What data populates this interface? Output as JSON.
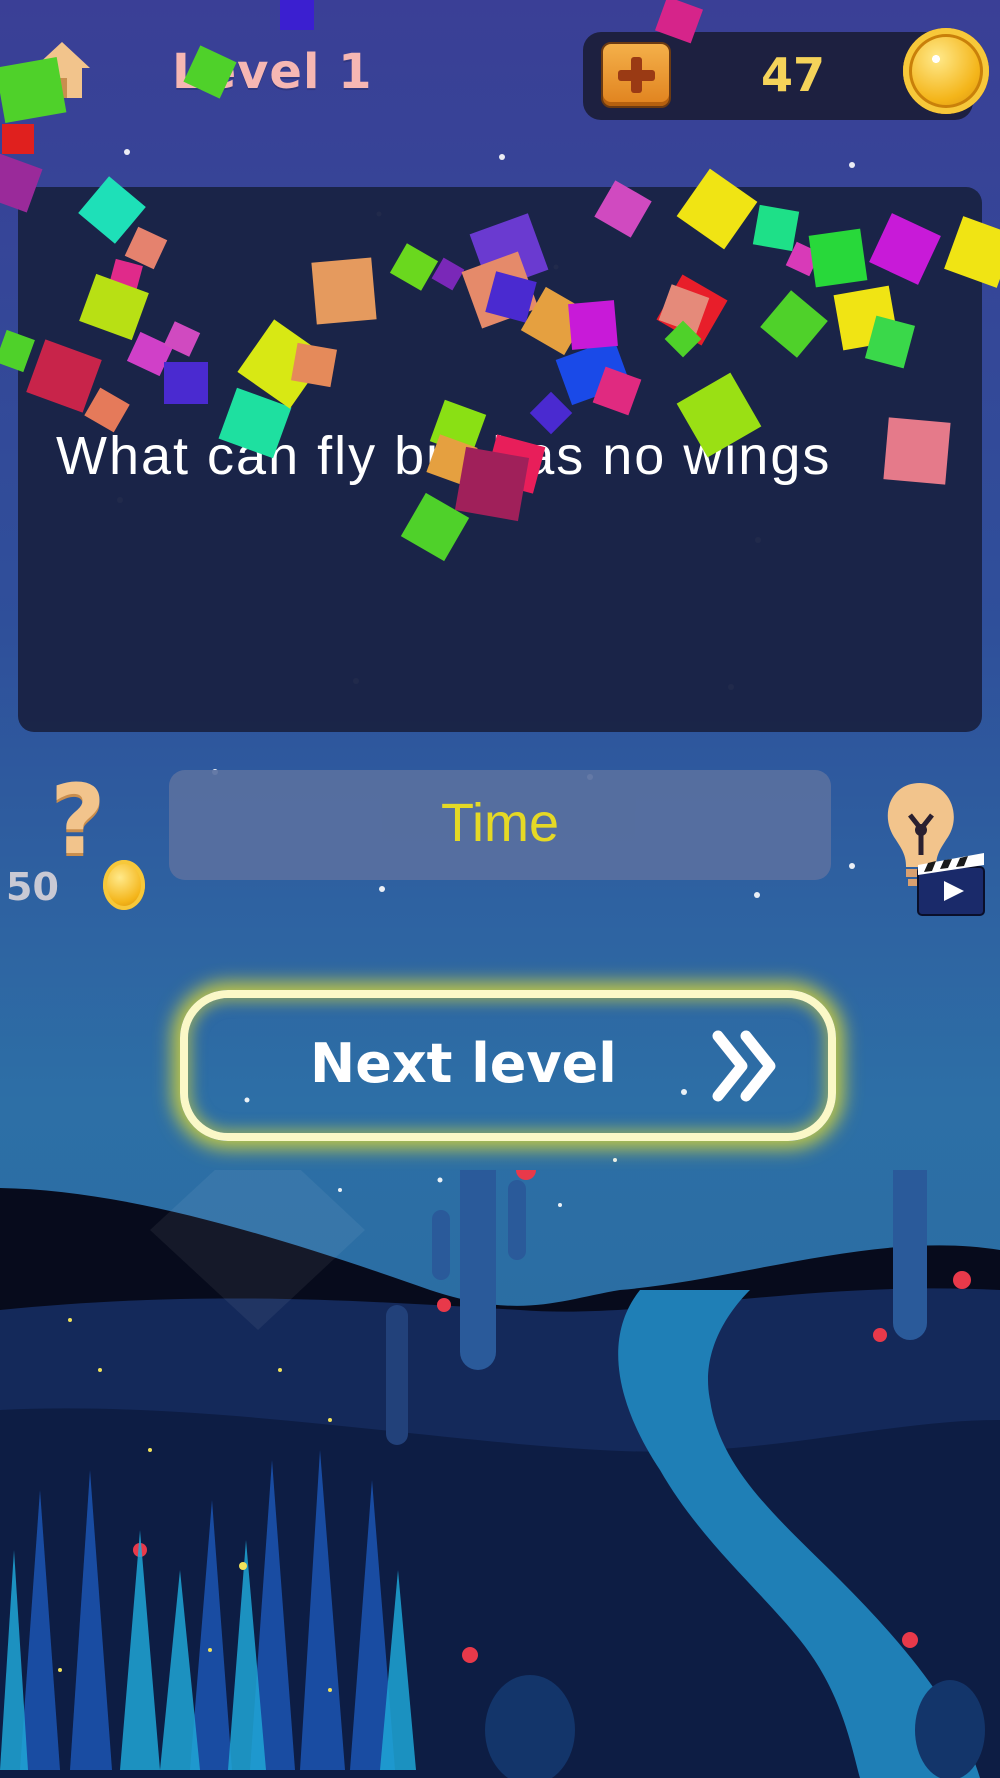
{
  "header": {
    "home_icon": "house-icon",
    "level_title": "Level 1",
    "coins": "47",
    "add_coins_icon": "plus-icon",
    "coin_icon": "gold-coin-icon"
  },
  "question": {
    "text": "What can fly but has no wings"
  },
  "hints": {
    "question_hint_icon": "question-mark-icon",
    "question_hint_cost": "50",
    "bulb_hint_icon": "lightbulb-icon",
    "video_icon": "clapperboard-play-icon"
  },
  "answer": {
    "text": "Time"
  },
  "next_button": {
    "label": "Next level",
    "icon": "double-chevron-right-icon"
  },
  "colors": {
    "answer_text": "#f5e41b",
    "level_title": "#f6b7b3",
    "coin_count": "#f5d35a",
    "button_glow": "#f0e628"
  }
}
